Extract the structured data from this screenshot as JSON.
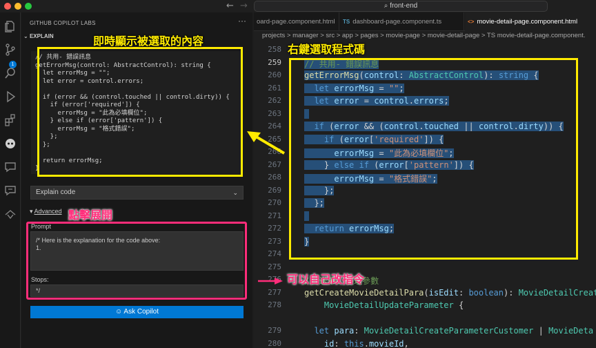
{
  "window": {
    "command_center": "front-end"
  },
  "sidebar": {
    "title": "GITHUB COPILOT LABS",
    "section": "EXPLAIN",
    "explain_code": "// 共用- 錯誤訊息\ngetErrorMsg(control: AbstractControl): string {\n  let errorMsg = \"\";\n  let error = control.errors;\n\n  if (error && (control.touched || control.dirty)) {\n    if (error['required']) {\n      errorMsg = \"此為必填欄位\";\n    } else if (error['pattern']) {\n      errorMsg = \"格式錯誤\";\n    };\n  };\n\n  return errorMsg;\n}",
    "select_value": "Explain code",
    "advanced_label": "Advanced",
    "prompt_label": "Prompt",
    "prompt_value": "/* Here is the explanation for the code above:\n1.",
    "stops_label": "Stops:",
    "stops_value": "*/",
    "ask_button": "Ask Copilot"
  },
  "annotations": {
    "selected_content": "即時顯示被選取的內容",
    "right_click_select": "右鍵選取程式碼",
    "click_expand": "點擊展開",
    "editable_prompt": "可以自己改指令"
  },
  "editor": {
    "tabs": [
      {
        "label": "oard-page.component.html",
        "icon": ""
      },
      {
        "label": "dashboard-page.component.ts",
        "icon": "TS"
      },
      {
        "label": "movie-detail-page.component.html",
        "icon": "<>"
      }
    ],
    "breadcrumb": "projects > manager > src > app > pages > movie-page > movie-detail-page > TS movie-detail-page.component.",
    "line_numbers": [
      "258",
      "259",
      "260",
      "261",
      "262",
      "263",
      "264",
      "265",
      "266",
      "267",
      "268",
      "269",
      "270",
      "271",
      "272",
      "273",
      "274",
      "275",
      "276",
      "277",
      "278",
      "",
      "279",
      "280"
    ],
    "lines": [
      {
        "text": ""
      },
      {
        "text": "// 共用- 錯誤訊息"
      },
      {
        "text": "getErrorMsg(control: AbstractControl): string {"
      },
      {
        "text": "  let errorMsg = \"\";"
      },
      {
        "text": "  let error = control.errors;"
      },
      {
        "text": ""
      },
      {
        "text": "  if (error && (control.touched || control.dirty)) {"
      },
      {
        "text": "    if (error['required']) {"
      },
      {
        "text": "      errorMsg = \"此為必填欄位\";"
      },
      {
        "text": "    } else if (error['pattern']) {"
      },
      {
        "text": "      errorMsg = \"格式錯誤\";"
      },
      {
        "text": "    };"
      },
      {
        "text": "  };"
      },
      {
        "text": ""
      },
      {
        "text": "  return errorMsg;"
      },
      {
        "text": "}"
      },
      {
        "text": ""
      },
      {
        "text": ""
      },
      {
        "text": "// 送單- 整理參數"
      },
      {
        "text": "getCreateMovieDetailPara(isEdit: boolean): MovieDetailCreat"
      },
      {
        "text": "    MovieDetailUpdateParameter {"
      },
      {
        "text": "  let para: MovieDetailCreateParameterCustomer | MovieDeta"
      },
      {
        "text": "    id: this.movieId,"
      }
    ]
  }
}
